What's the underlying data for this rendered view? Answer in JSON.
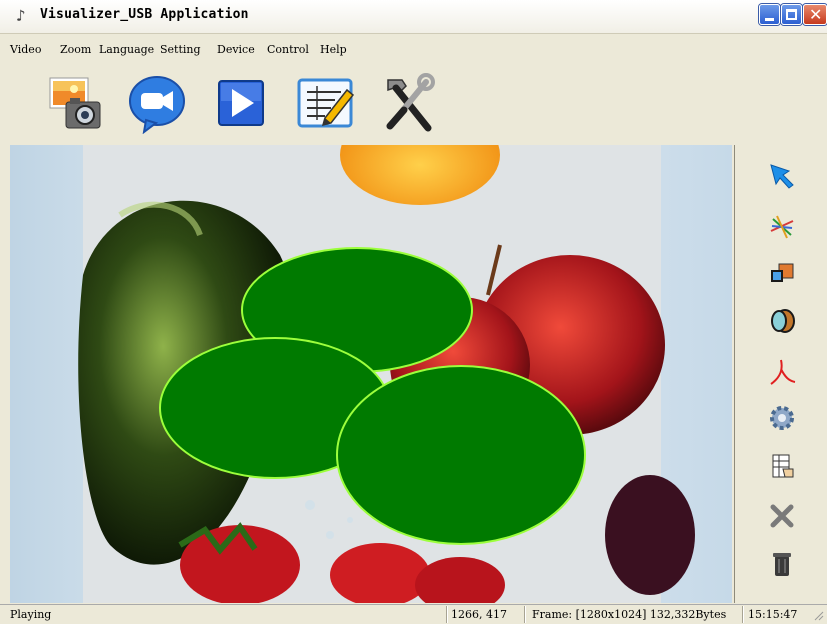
{
  "window": {
    "title": "Visualizer_USB Application"
  },
  "menu": [
    "Video",
    "Zoom",
    "Language",
    "Setting",
    "Device",
    "Control",
    "Help"
  ],
  "toolbar": [
    {
      "icon": "photo-camera-icon"
    },
    {
      "icon": "video-camera-icon"
    },
    {
      "icon": "play-icon"
    },
    {
      "icon": "annotate-icon"
    },
    {
      "icon": "tools-icon"
    }
  ],
  "side_tools": [
    {
      "icon": "pointer-arrow-icon"
    },
    {
      "icon": "freehand-lines-icon"
    },
    {
      "icon": "shapes-icon"
    },
    {
      "icon": "ellipse-tool-icon"
    },
    {
      "icon": "pen-line-icon"
    },
    {
      "icon": "gear-icon"
    },
    {
      "icon": "table-hand-icon"
    },
    {
      "icon": "delete-x-icon"
    },
    {
      "icon": "trash-icon"
    }
  ],
  "overlay": {
    "fill_color": "#007a00",
    "stroke_color": "#9cff3c"
  },
  "status": {
    "state": "Playing",
    "coords": "1266, 417",
    "frame": "Frame: [1280x1024] 132,332Bytes",
    "time": "15:15:47"
  }
}
